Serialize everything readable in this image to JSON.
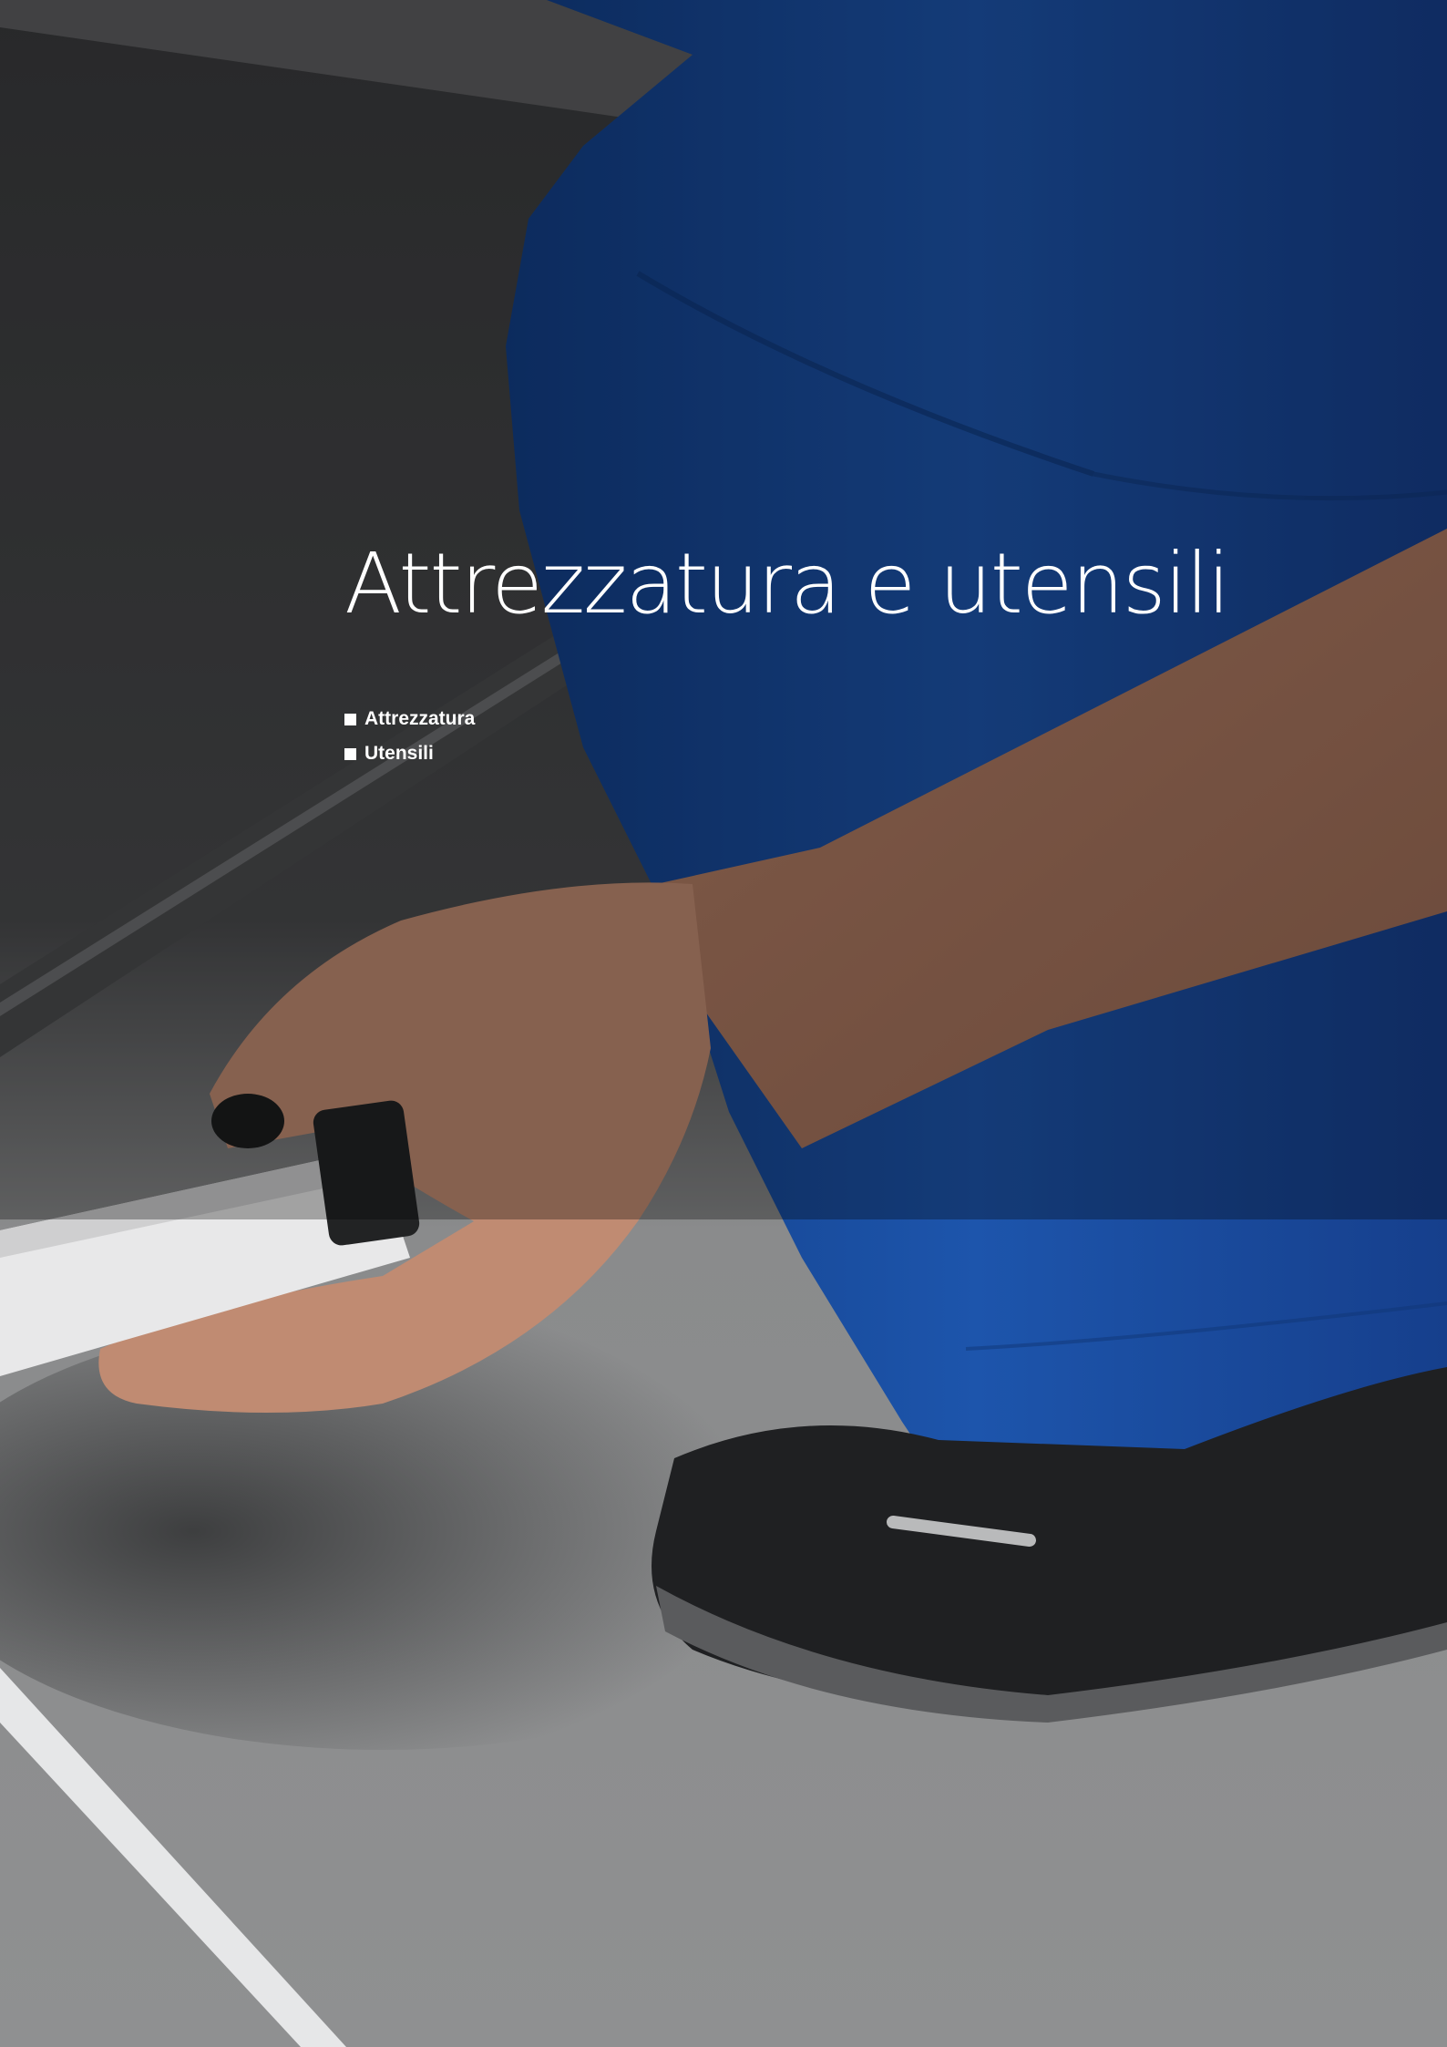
{
  "heading": {
    "title": "Attrezzatura e utensili"
  },
  "sections": [
    {
      "label": "Attrezzatura"
    },
    {
      "label": "Utensili"
    }
  ],
  "colors": {
    "floor": "#8c8d8e",
    "workwear_blue": "#1a4fa0",
    "text": "#ffffff"
  }
}
